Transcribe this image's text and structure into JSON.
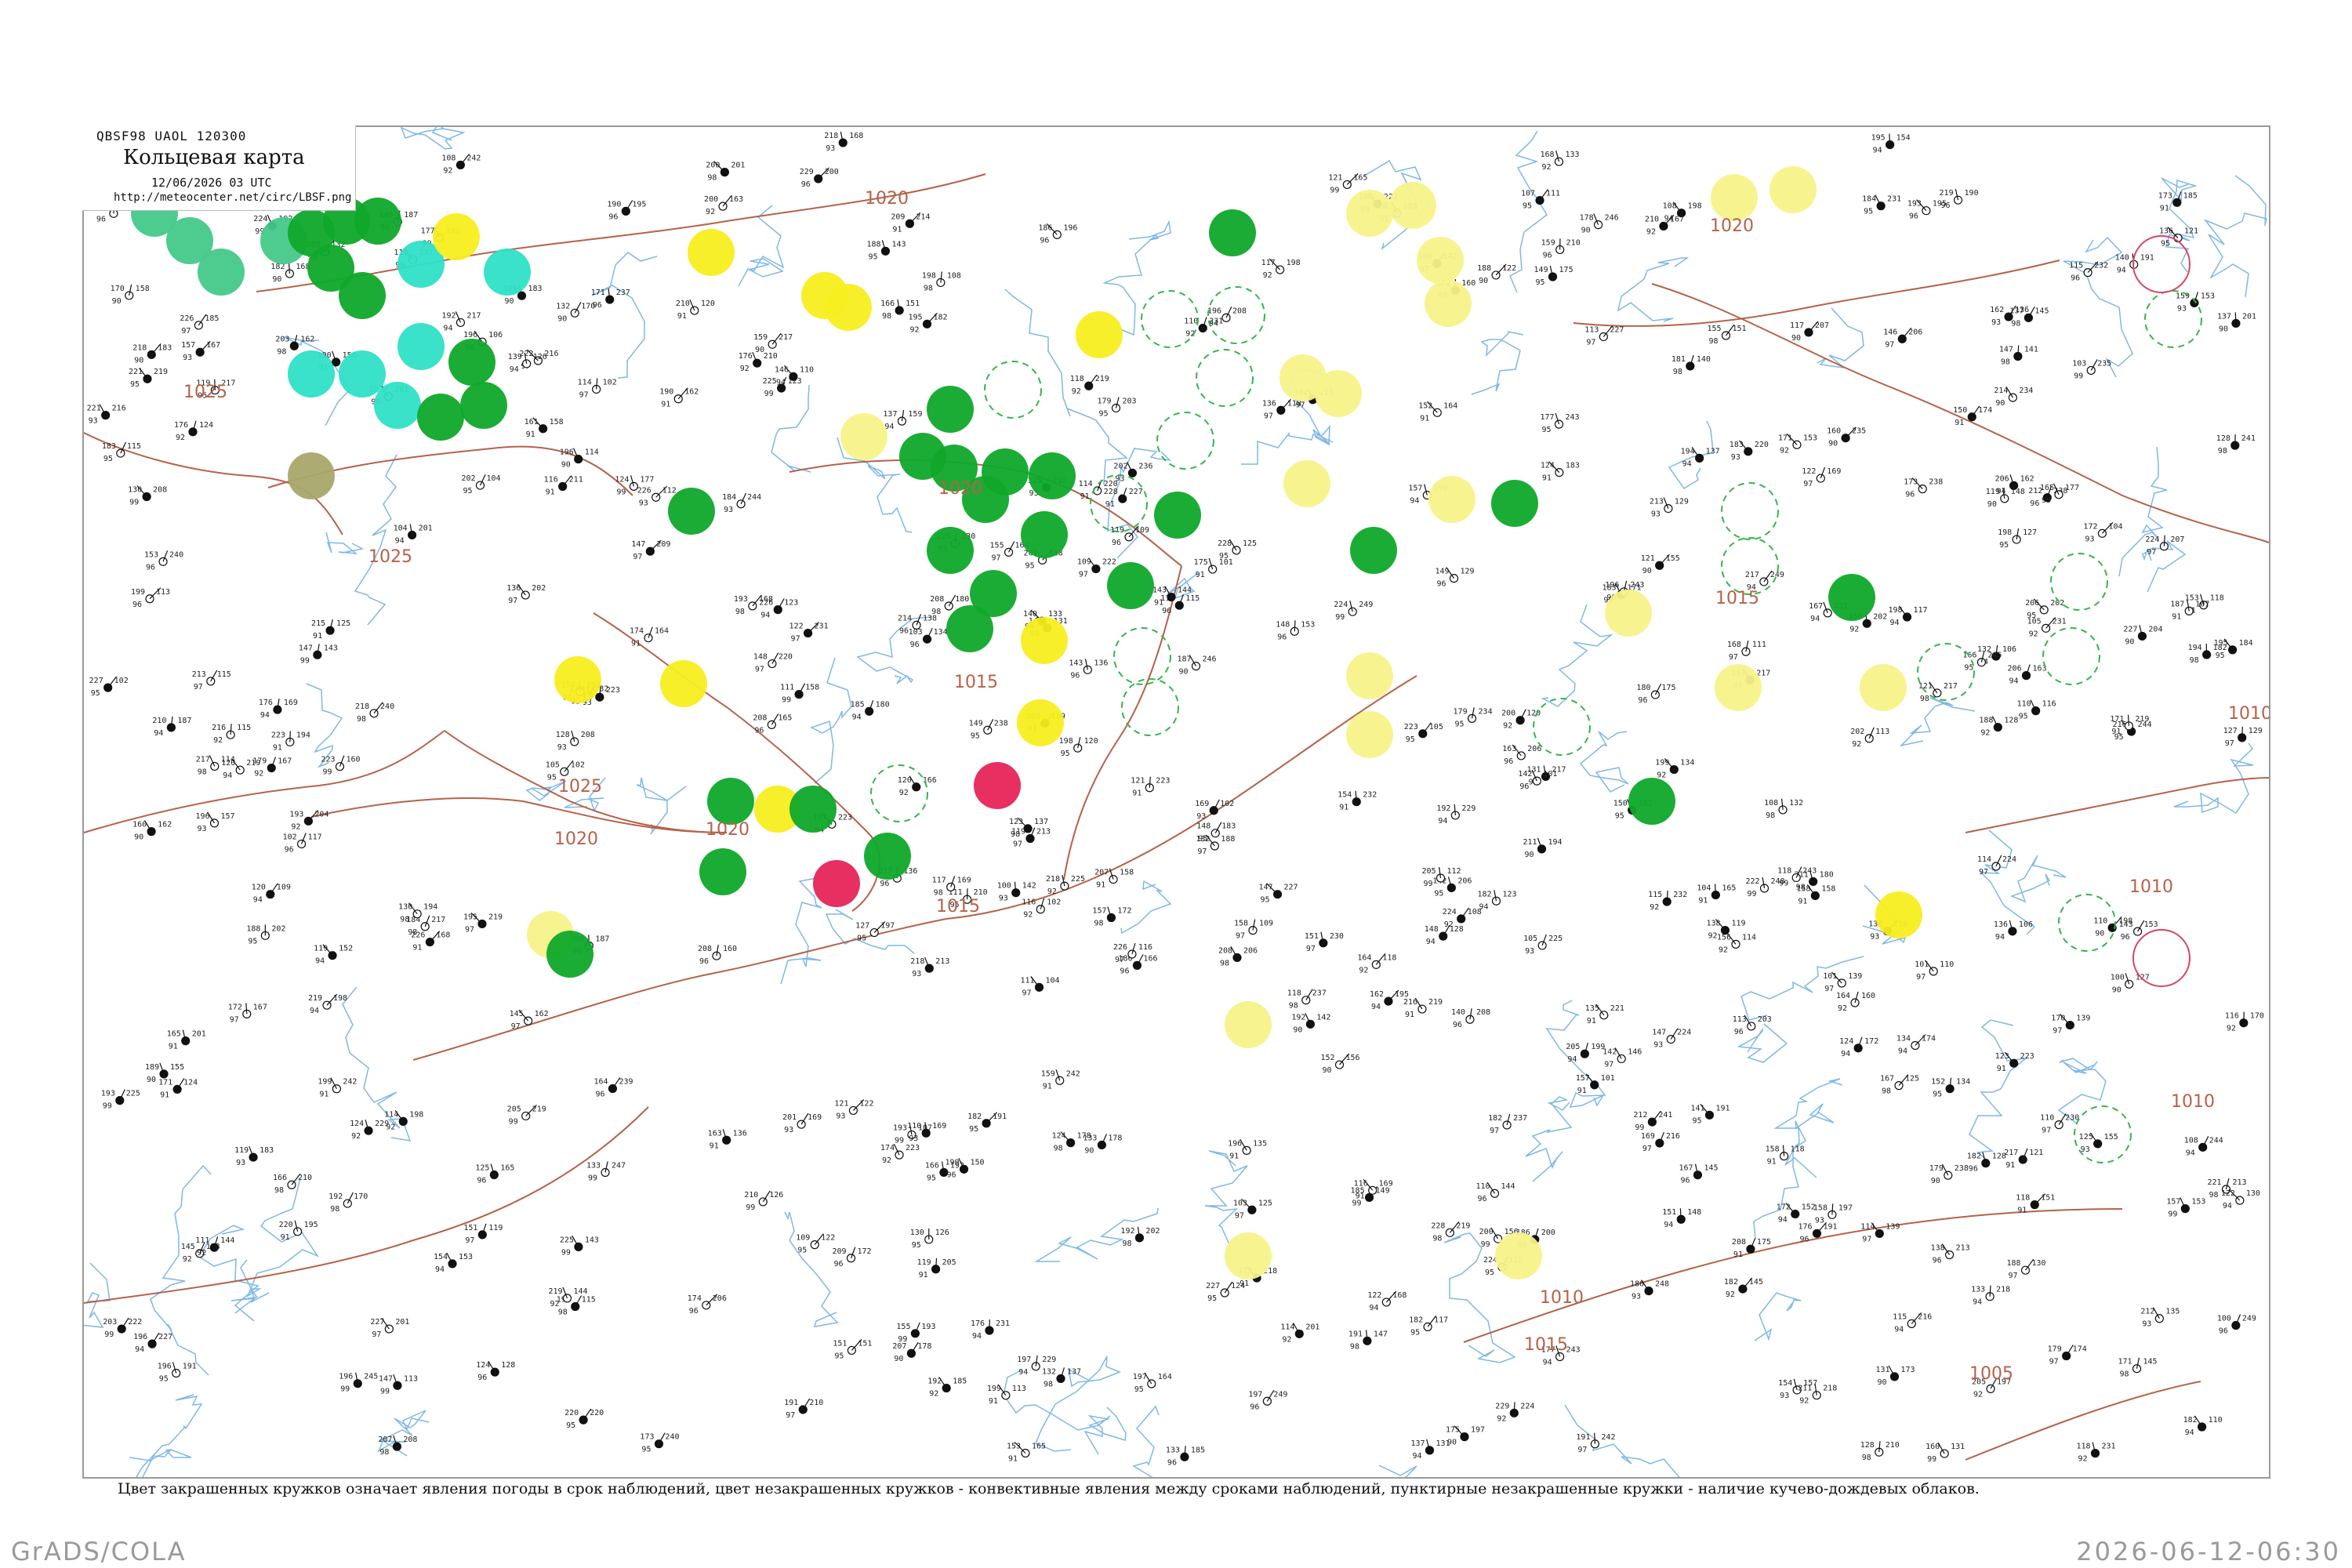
{
  "header": {
    "code": "QBSF98  UAOL  120300",
    "title": "Кольцевая карта",
    "date": "12/06/2026 03 UTC",
    "url": "http://meteocenter.net/circ/LBSF.png"
  },
  "footnote": "Цвет закрашенных кружков означает явления погоды в срок наблюдений, цвет незакрашенных кружков - конвективные явления между сроками наблюдений, пунктирные незакрашенные кружки - наличие кучево-дождевых облаков.",
  "footer": {
    "left": "GrADS/COLA",
    "right": "2026-06-12-06:30"
  },
  "isobars": [
    {
      "label": "1025"
    },
    {
      "label": "1025"
    },
    {
      "label": "1020"
    },
    {
      "label": "1020"
    },
    {
      "label": "1020"
    },
    {
      "label": "1020"
    },
    {
      "label": "1015"
    },
    {
      "label": "1015"
    },
    {
      "label": "1015"
    },
    {
      "label": "1015"
    },
    {
      "label": "1010"
    },
    {
      "label": "1010"
    },
    {
      "label": "1010"
    },
    {
      "label": "1010"
    },
    {
      "label": "1005"
    },
    {
      "label": "1025"
    },
    {
      "label": "1020"
    }
  ],
  "colors": {
    "green": "#0fa82a",
    "light_green": "#44c98a",
    "cyan": "#2ee0c6",
    "yellow": "#f8ee20",
    "pale_yellow": "#f7f38a",
    "red": "#e6245a",
    "olive": "#a8a76a",
    "isobar": "#b5624a",
    "river": "#7fb8e6",
    "dashed_ring": "#35b54a",
    "red_ring": "#d8456a"
  }
}
